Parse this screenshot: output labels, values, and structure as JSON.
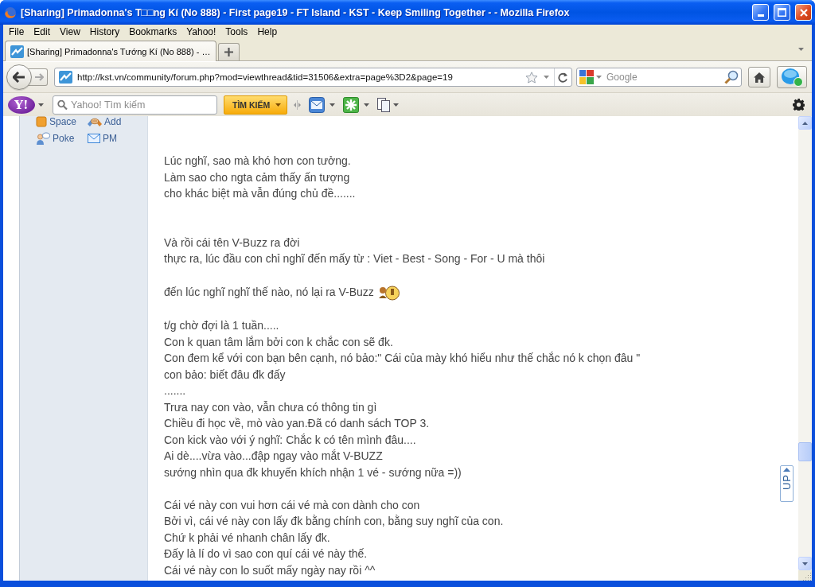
{
  "window": {
    "title": "[Sharing] Primadonna's T□□ng Kí (No 888) - First page19 - FT Island - KST - Keep Smiling Together - - Mozilla Firefox"
  },
  "menu": [
    "File",
    "Edit",
    "View",
    "History",
    "Bookmarks",
    "Yahoo!",
    "Tools",
    "Help"
  ],
  "tabs": [
    {
      "label": "[Sharing] Primadonna's Tướng Kí (No 888) - …",
      "selected": true
    }
  ],
  "navigation": {
    "back": {
      "disabled": false
    },
    "forward": {
      "disabled": true
    },
    "url": "http://kst.vn/community/forum.php?mod=viewthread&tid=31506&extra=page%3D2&page=19",
    "search": {
      "placeholder": "Google"
    }
  },
  "yahoo_toolbar": {
    "logo": "Y!",
    "search": {
      "placeholder": "Yahoo! Tìm kiếm"
    },
    "search_button": "TÌM KIẾM"
  },
  "sidebar": {
    "actions": [
      "Space",
      "Add",
      "Poke",
      "PM"
    ]
  },
  "post": {
    "paragraphs": [
      {
        "lines": [
          "Lúc nghĩ, sao mà khó hơn con tưởng.",
          "Làm sao cho ngta cảm thấy ấn tượng",
          "cho khác biệt mà vẫn đúng chủ đề......."
        ]
      },
      {
        "lines": [
          "Và rồi cái tên V-Buzz ra đời",
          "thực ra, lúc đầu con chỉ nghĩ đến mấy từ : Viet - Best - Song - For - U mà thôi"
        ]
      },
      {
        "lines": [
          "đến lúc nghĩ nghĩ thế nào, nó lại ra V-Buzz"
        ],
        "emoticon": true
      },
      {
        "lines": [
          "t/g chờ đợi là 1 tuần.....",
          "Con k quan tâm lắm bởi con k chắc con sẽ đk.",
          "Con đem kể với con bạn bên cạnh, nó bảo:\" Cái của mày khó hiểu như thế chắc nó k chọn đâu \"",
          "con bảo: biết đâu đk đấy",
          ".......",
          "Trưa nay con vào, vẫn chưa có thông tin gì",
          "Chiều đi học về, mò vào yan.Đã có danh sách TOP 3.",
          "Con kick vào với ý nghĩ: Chắc k có tên mình đâu....",
          "Ai dè....vừa vào...đập ngay vào mắt V-BUZZ",
          "sướng nhìn qua đk khuyến khích nhận 1 vé - sướng nữa =))"
        ]
      },
      {
        "lines": [
          "Cái vé này con vui hơn cái vé mà con dành cho con",
          "Bởi vì, cái vé này con lấy đk bằng chính con, bằng suy nghĩ của con.",
          "Chứ k phải vé nhanh chân lấy đk.",
          "Đấy là lí do vì sao con quí cái vé này thế.",
          "Cái vé này con lo suốt mấy ngày nay rồi ^^"
        ]
      }
    ]
  },
  "back_to_top": {
    "label": "UP"
  }
}
